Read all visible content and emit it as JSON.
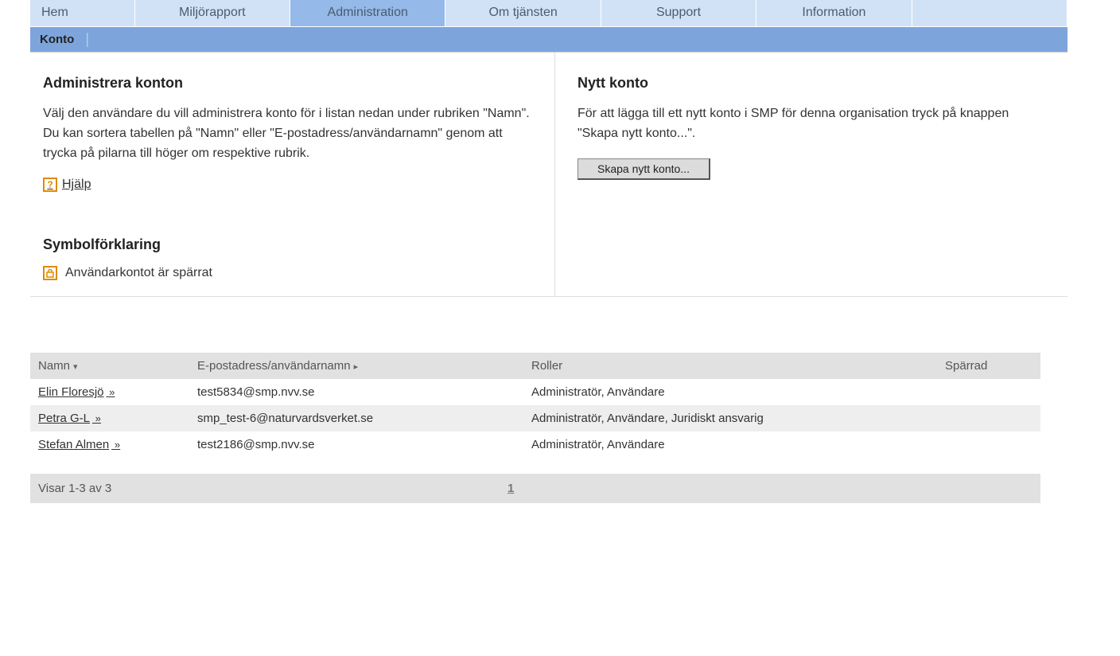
{
  "nav": {
    "tabs": [
      {
        "label": "Hem"
      },
      {
        "label": "Miljörapport"
      },
      {
        "label": "Administration",
        "active": true
      },
      {
        "label": "Om tjänsten"
      },
      {
        "label": "Support"
      },
      {
        "label": "Information"
      },
      {
        "label": ""
      }
    ]
  },
  "subnav": {
    "item": "Konto"
  },
  "left": {
    "heading": "Administrera konton",
    "paragraph": "Välj den användare du vill administrera konto för i listan nedan under rubriken \"Namn\". Du kan sortera tabellen på \"Namn\" eller \"E-postadress/användarnamn\" genom att trycka på pilarna till höger om respektive rubrik.",
    "help_label": " Hjälp",
    "legend_heading": "Symbolförklaring",
    "legend_text": "Användarkontot är spärrat"
  },
  "right": {
    "heading": "Nytt konto",
    "paragraph": "För att lägga till ett nytt konto i SMP för denna organisation tryck på knappen \"Skapa nytt konto...\".",
    "button_label": "Skapa nytt konto..."
  },
  "table": {
    "headers": {
      "name": "Namn",
      "email": "E-postadress/användarnamn",
      "roles": "Roller",
      "locked": "Spärrad"
    },
    "sort": {
      "name": "▾",
      "email": "▸"
    },
    "rows": [
      {
        "name": "Elin Floresjö",
        "email": "test5834@smp.nvv.se",
        "roles": "Administratör, Användare",
        "locked": ""
      },
      {
        "name": "Petra G-L",
        "email": "smp_test-6@naturvardsverket.se",
        "roles": "Administratör, Användare, Juridiskt ansvarig",
        "locked": ""
      },
      {
        "name": "Stefan Almen",
        "email": "test2186@smp.nvv.se",
        "roles": "Administratör, Användare",
        "locked": ""
      }
    ]
  },
  "pager": {
    "count_text": "Visar 1-3 av 3",
    "page": "1"
  }
}
